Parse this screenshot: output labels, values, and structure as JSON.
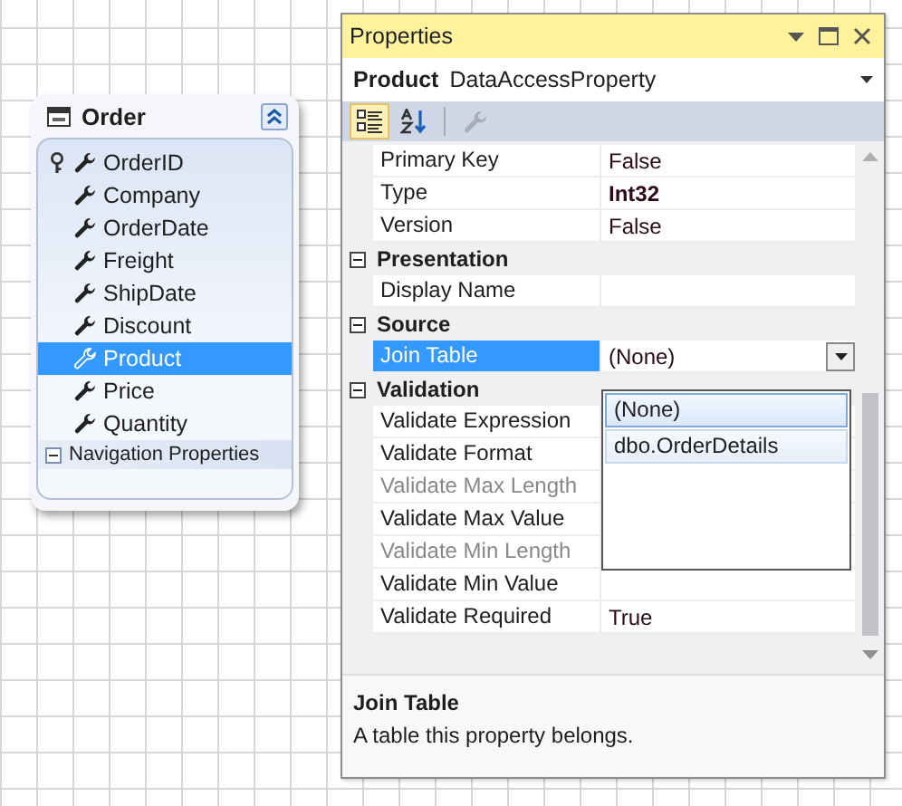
{
  "entity": {
    "title": "Order",
    "collapsed": false,
    "properties": [
      {
        "name": "OrderID",
        "key": true,
        "selected": false
      },
      {
        "name": "Company",
        "key": false,
        "selected": false
      },
      {
        "name": "OrderDate",
        "key": false,
        "selected": false
      },
      {
        "name": "Freight",
        "key": false,
        "selected": false
      },
      {
        "name": "ShipDate",
        "key": false,
        "selected": false
      },
      {
        "name": "Discount",
        "key": false,
        "selected": false
      },
      {
        "name": "Product",
        "key": false,
        "selected": true
      },
      {
        "name": "Price",
        "key": false,
        "selected": false
      },
      {
        "name": "Quantity",
        "key": false,
        "selected": false
      }
    ],
    "navigation": {
      "label": "Navigation Properties",
      "expanded": true
    }
  },
  "properties_window": {
    "title": "Properties",
    "object": {
      "name": "Product",
      "type": "DataAccessProperty"
    },
    "toolbar": [
      {
        "kind": "categorized",
        "selected": true
      },
      {
        "kind": "alphabetical",
        "selected": false
      },
      {
        "kind": "property-pages",
        "selected": false,
        "disabled": true
      }
    ],
    "rows": [
      {
        "kind": "property",
        "name": "Primary Key",
        "value": "False",
        "modified": false,
        "disabled": false,
        "selected": false
      },
      {
        "kind": "property",
        "name": "Type",
        "value": "Int32",
        "modified": true,
        "disabled": false,
        "selected": false
      },
      {
        "kind": "property",
        "name": "Version",
        "value": "False",
        "modified": false,
        "disabled": false,
        "selected": false
      },
      {
        "kind": "category",
        "name": "Presentation",
        "expanded": true
      },
      {
        "kind": "property",
        "name": "Display Name",
        "disabled": false,
        "selected": false
      },
      {
        "kind": "category",
        "name": "Source",
        "expanded": true
      },
      {
        "kind": "property",
        "name": "Join Table",
        "value": "(None)",
        "modified": false,
        "disabled": false,
        "selected": true,
        "dropdown": true
      },
      {
        "kind": "category",
        "name": "Validation",
        "expanded": true
      },
      {
        "kind": "property",
        "name": "Validate Expression",
        "disabled": false,
        "selected": false
      },
      {
        "kind": "property",
        "name": "Validate Format",
        "disabled": false,
        "selected": false
      },
      {
        "kind": "property",
        "name": "Validate Max Length",
        "disabled": true,
        "selected": false
      },
      {
        "kind": "property",
        "name": "Validate Max Value",
        "disabled": false,
        "selected": false
      },
      {
        "kind": "property",
        "name": "Validate Min Length",
        "disabled": true,
        "selected": false
      },
      {
        "kind": "property",
        "name": "Validate Min Value",
        "disabled": false,
        "selected": false
      },
      {
        "kind": "property",
        "name": "Validate Required",
        "value": "True",
        "modified": false,
        "disabled": false,
        "selected": false
      }
    ],
    "dropdown_options": [
      {
        "label": "(None)",
        "selected": true
      },
      {
        "label": "dbo.OrderDetails",
        "selected": false
      }
    ],
    "description": {
      "title": "Join Table",
      "text": "A table this property belongs."
    }
  }
}
